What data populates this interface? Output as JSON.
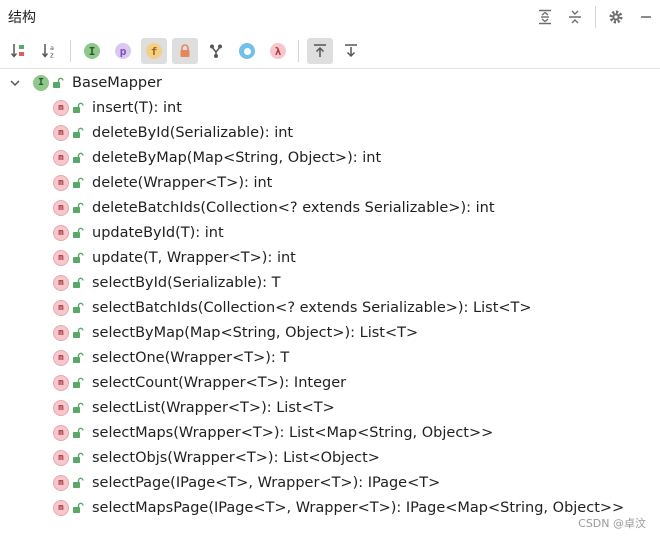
{
  "header": {
    "title": "结构"
  },
  "tree": {
    "root": {
      "badge": "I",
      "label": "BaseMapper"
    },
    "method_badge": "m",
    "methods": [
      "insert(T): int",
      "deleteById(Serializable): int",
      "deleteByMap(Map<String, Object>): int",
      "delete(Wrapper<T>): int",
      "deleteBatchIds(Collection<? extends Serializable>): int",
      "updateById(T): int",
      "update(T, Wrapper<T>): int",
      "selectById(Serializable): T",
      "selectBatchIds(Collection<? extends Serializable>): List<T>",
      "selectByMap(Map<String, Object>): List<T>",
      "selectOne(Wrapper<T>): T",
      "selectCount(Wrapper<T>): Integer",
      "selectList(Wrapper<T>): List<T>",
      "selectMaps(Wrapper<T>): List<Map<String, Object>>",
      "selectObjs(Wrapper<T>): List<Object>",
      "selectPage(IPage<T>, Wrapper<T>): IPage<T>",
      "selectMapsPage(IPage<T>, Wrapper<T>): IPage<Map<String, Object>>"
    ]
  },
  "toolbar": {
    "sort_alpha_label": "z",
    "inherited_badge": "I",
    "properties_badge": "p",
    "fields_badge": "f",
    "lambdas_badge": "λ"
  },
  "watermark": "CSDN @卓汶",
  "colors": {
    "interface_badge": "#8fc78c",
    "method_badge": "#f7c7cc",
    "lock_green": "#59a869",
    "accent_blue": "#4a90d9"
  }
}
